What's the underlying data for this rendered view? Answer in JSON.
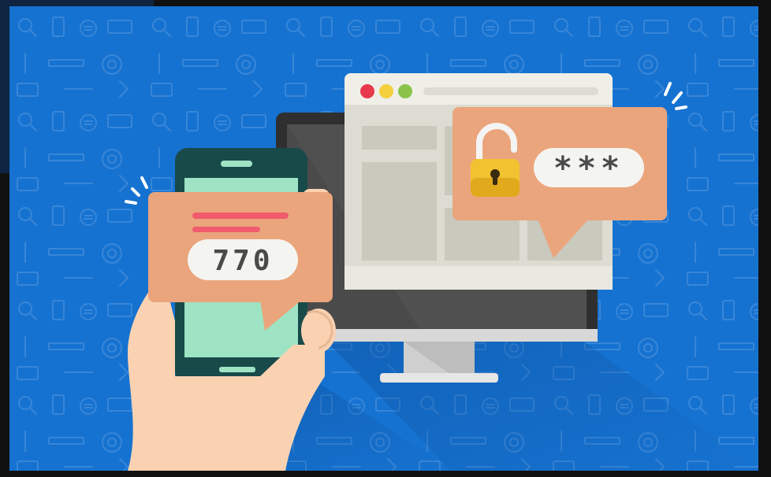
{
  "otp_code": "770",
  "password_mask": "***",
  "colors": {
    "background": "#1672d0",
    "bubble": "#eba57c",
    "lock": "#f2c230",
    "phone_body": "#184a4a",
    "phone_screen": "#9ee3c4",
    "monitor_bezel": "#2f2f2f",
    "browser_window": "#d9d9cf",
    "skin": "#fbd2b1"
  },
  "icons": [
    "lock-open-icon",
    "smartphone-icon",
    "monitor-icon",
    "browser-window-icon",
    "hand-icon",
    "speech-bubble-icon"
  ]
}
